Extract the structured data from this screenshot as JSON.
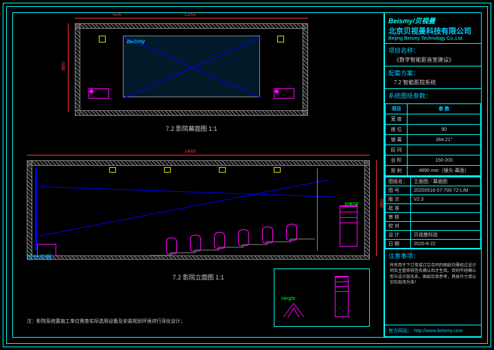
{
  "company": {
    "logo": "Beismy/贝视曼",
    "cn": "北京贝视曼科技有限公司",
    "en": "Beijing Beismy Technology Co.,Ltd"
  },
  "project": {
    "label": "项目名称：",
    "value": "《数字智能影音室建设》"
  },
  "scheme": {
    "label": "配套方案：",
    "value": "7.2 智能影院系统"
  },
  "params": {
    "label": "系统图纸参数：",
    "h_item": "项目",
    "h_val": "参 数",
    "rows": [
      {
        "k": "宽 度",
        "v": ""
      },
      {
        "k": "座 位",
        "v": "90"
      },
      {
        "k": "银 幕",
        "v": "364.21\""
      },
      {
        "k": "民 间",
        "v": ""
      },
      {
        "k": "台 阶",
        "v": "150-200"
      },
      {
        "k": "投 射",
        "v": "4890 mm（镜头-幕面）"
      }
    ]
  },
  "info": {
    "label": "图纸名：",
    "name": "立面图／幕面图",
    "rows": [
      {
        "k": "图 号",
        "v": "20200516-07-700-72-L/M"
      },
      {
        "k": "版 次",
        "v": "V2.3"
      },
      {
        "k": "批 准",
        "v": ""
      },
      {
        "k": "审 核",
        "v": ""
      },
      {
        "k": "校 对",
        "v": ""
      },
      {
        "k": "设 计",
        "v": "贝视曼科技"
      },
      {
        "k": "日 期",
        "v": "2020-6-22"
      }
    ]
  },
  "notice": {
    "label": "注意事项：",
    "text": "所有用于下订单或订立合同的图纸均需经过设计师及主管审核签名确认后才生效。否则不经确认而与设计部天系，图纸仅供参考，具体尺寸请以实际现场为准！",
    "site_label": "官方网站：",
    "site": "http://www.beismy.com"
  },
  "views": {
    "top_title": "7.2  影院幕面图   1:1",
    "bot_title": "7.2  影院立面图   1:1"
  },
  "design_label": "设计说明：",
  "foot": "注：影院系统置施工单位需查实际选用设备及安装规划环境进行深化设计；",
  "dims": {
    "top_w": "12050",
    "top_left": "4200",
    "top_h": "3800",
    "bot_w": "14000",
    "bot_h": "3850"
  },
  "ctrl_room": "控制室",
  "screen_logo": "Beismy"
}
